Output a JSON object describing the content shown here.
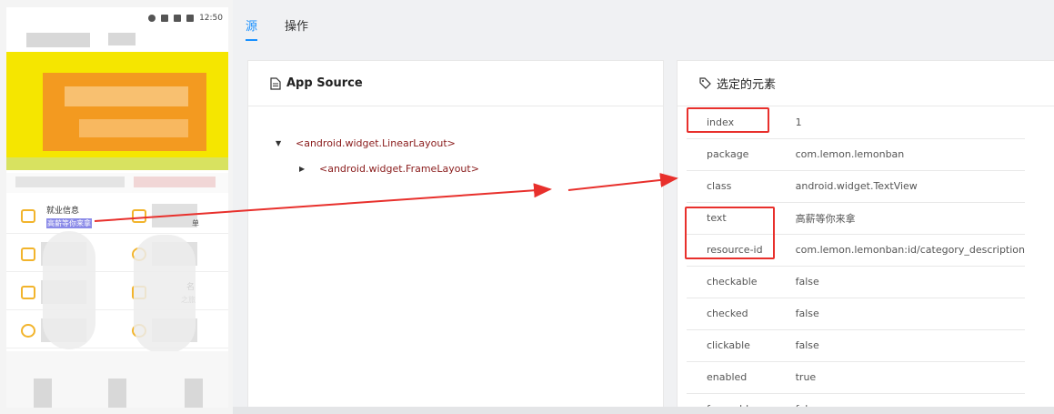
{
  "status_bar": {
    "time": "12:50"
  },
  "device": {
    "grid_item": {
      "title": "就业信息",
      "subtitle": "高薪等你来拿"
    },
    "partial_labels": [
      "单",
      "名",
      "之旅"
    ]
  },
  "tabs": [
    {
      "label": "源",
      "active": true
    },
    {
      "label": "操作",
      "active": false
    }
  ],
  "source_panel": {
    "title": "App Source",
    "tree": [
      {
        "label": "<android.widget.LinearLayout>",
        "expanded": true
      },
      {
        "label": "<android.widget.FrameLayout>",
        "expanded": false
      }
    ]
  },
  "selected_panel": {
    "title": "选定的元素",
    "attributes": [
      {
        "key": "index",
        "value": "1"
      },
      {
        "key": "package",
        "value": "com.lemon.lemonban"
      },
      {
        "key": "class",
        "value": "android.widget.TextView"
      },
      {
        "key": "text",
        "value": "高薪等你来拿"
      },
      {
        "key": "resource-id",
        "value": "com.lemon.lemonban:id/category_description"
      },
      {
        "key": "checkable",
        "value": "false"
      },
      {
        "key": "checked",
        "value": "false"
      },
      {
        "key": "clickable",
        "value": "false"
      },
      {
        "key": "enabled",
        "value": "true"
      },
      {
        "key": "focusable",
        "value": "false"
      }
    ]
  },
  "colors": {
    "accent": "#1890ff",
    "annotation": "#e8302c",
    "highlight": "#8a8ae8"
  }
}
